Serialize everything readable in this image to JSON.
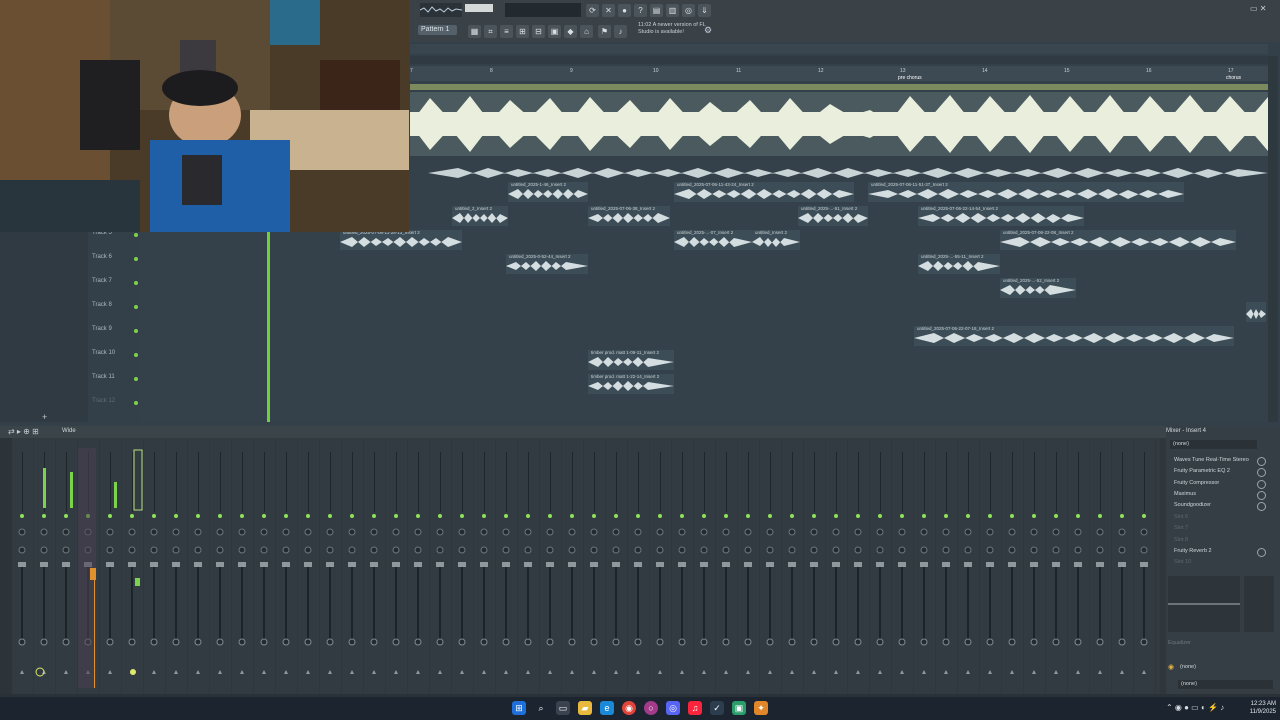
{
  "toolbar": {
    "pattern_label": "Pattern 1",
    "notice_time": "11:02",
    "notice_text": "A newer version of FL Studio is available!"
  },
  "playlist": {
    "ruler_ticks": [
      "7",
      "8",
      "9",
      "10",
      "11",
      "12",
      "13",
      "14",
      "15",
      "16",
      "17"
    ],
    "markers": [
      "pre chorus",
      "chorus"
    ],
    "tracks": [
      "Track 5",
      "Track 6",
      "Track 7",
      "Track 8",
      "Track 9",
      "Track 10",
      "Track 11",
      "Track 12"
    ],
    "clips": [
      {
        "label": "untitled_2025-1-46_Insert 2"
      },
      {
        "label": "untitled_2025-07-06-11-43-24_Insert 2"
      },
      {
        "label": "untitled_2025-07-06-11-51-37_Insert 2"
      },
      {
        "label": "untitled_2_Insert 2"
      },
      {
        "label": "untitled_2025-07-06-38_Insert 2"
      },
      {
        "label": "untitled_2025-...-51_Insert 2"
      },
      {
        "label": "untitled_2025-07-06-22-14-54_Insert 2"
      },
      {
        "label": "untitled_2025-07-06-11-28-13_Insert 2"
      },
      {
        "label": "untitled_2025-...-07_Insert 2"
      },
      {
        "label": "untitled_Insert 2"
      },
      {
        "label": "untitled_2025-07-06-22-08_Insert 2"
      },
      {
        "label": "untitled_2025-0-52-44_Insert 2"
      },
      {
        "label": "untitled_2025-...-55-11_Insert 2"
      },
      {
        "label": "untitled_2025-...-52_Insert 2"
      },
      {
        "label": "untitled_2025-07-06-22-07-18_Insert 2"
      },
      {
        "label": "timber prod. matt 1-09-11_Insert 2"
      },
      {
        "label": "timber prod. matt 1-22-14_Insert 2"
      }
    ]
  },
  "mixer": {
    "toolbar_label": "Wide",
    "panel_title": "Mixer - Insert 4",
    "input": "(none)",
    "slots": [
      {
        "label": "Waves Tune Real-Time Stereo",
        "active": true
      },
      {
        "label": "Fruity Parametric EQ 2",
        "active": true
      },
      {
        "label": "Fruity Compressor",
        "active": true
      },
      {
        "label": "Maximus",
        "active": true
      },
      {
        "label": "Soundgoodizer",
        "active": true
      },
      {
        "label": "Slot 6",
        "active": false
      },
      {
        "label": "Slot 7",
        "active": false
      },
      {
        "label": "Slot 8",
        "active": false
      },
      {
        "label": "Fruity Reverb 2",
        "active": true
      },
      {
        "label": "Slot 10",
        "active": false
      }
    ],
    "eq_label": "Equalizer",
    "output_a": "(none)",
    "output_b": "(none)"
  },
  "taskbar": {
    "time": "12:23 AM",
    "date": "11/9/2025"
  },
  "colors": {
    "accent_green": "#7cd24a",
    "accent_orange": "#e0902c",
    "bg": "#2b3237"
  }
}
